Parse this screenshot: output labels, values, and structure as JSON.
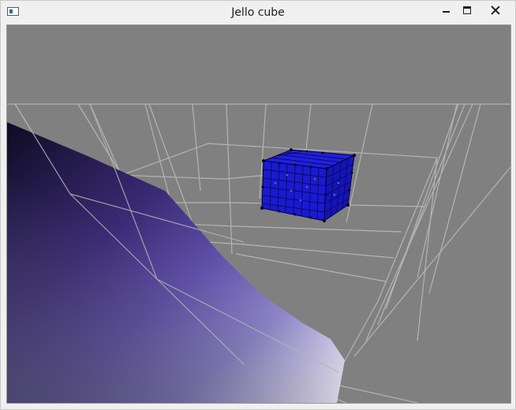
{
  "window": {
    "title": "Jello cube",
    "icon": "app-window-icon",
    "controls": {
      "minimize_icon": "minimize-icon",
      "maximize_icon": "maximize-icon",
      "close_icon": "close-icon"
    }
  },
  "scene": {
    "background": "#808080",
    "grid_color": "#b4b4b4",
    "inclined_plane_colors": [
      "#0e0c24",
      "#3a2b75",
      "#6a5bb5",
      "#a99ee0",
      "#ffffff"
    ],
    "cube_color": "#1a1adc",
    "cube_edge_color": "#000033"
  }
}
